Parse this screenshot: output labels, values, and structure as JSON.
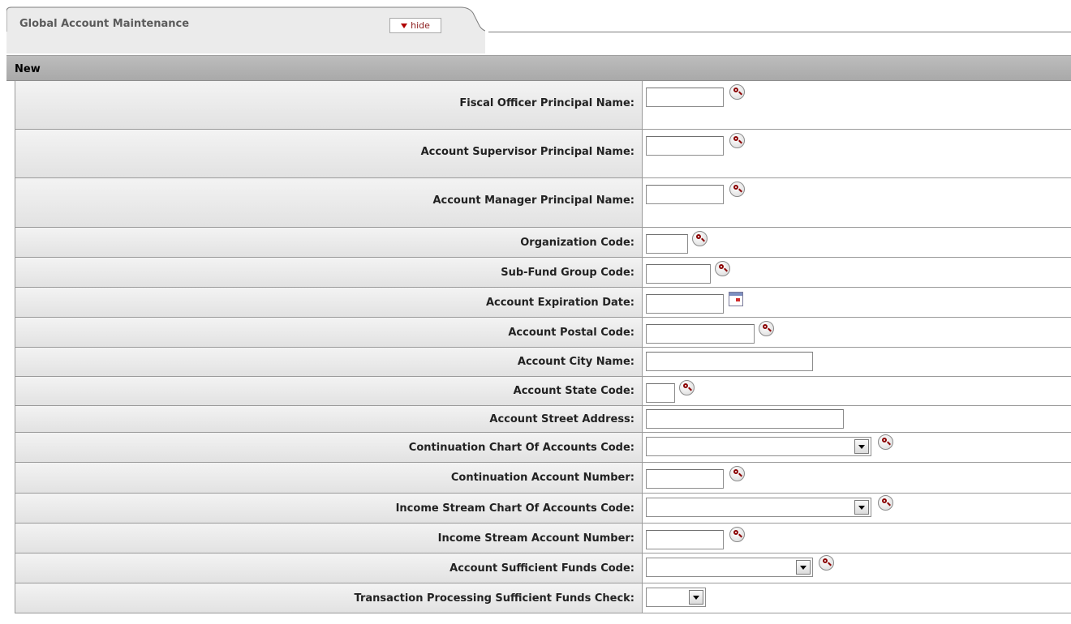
{
  "tab": {
    "title": "Global Account Maintenance",
    "hide_label": "hide"
  },
  "section": {
    "title": "New"
  },
  "fields": [
    {
      "label": "Fiscal Officer Principal Name:",
      "control": "text",
      "value": "",
      "icon": "lookup-icon"
    },
    {
      "label": "Account Supervisor Principal Name:",
      "control": "text",
      "value": "",
      "icon": "lookup-icon"
    },
    {
      "label": "Account Manager Principal Name:",
      "control": "text",
      "value": "",
      "icon": "lookup-icon"
    },
    {
      "label": "Organization Code:",
      "control": "text",
      "value": "",
      "icon": "lookup-icon"
    },
    {
      "label": "Sub-Fund Group Code:",
      "control": "text",
      "value": "",
      "icon": "lookup-icon"
    },
    {
      "label": "Account Expiration Date:",
      "control": "text",
      "value": "",
      "icon": "calendar-icon"
    },
    {
      "label": "Account Postal Code:",
      "control": "text",
      "value": "",
      "icon": "lookup-icon"
    },
    {
      "label": "Account City Name:",
      "control": "text",
      "value": ""
    },
    {
      "label": "Account State Code:",
      "control": "text",
      "value": "",
      "icon": "lookup-icon"
    },
    {
      "label": "Account Street Address:",
      "control": "text",
      "value": ""
    },
    {
      "label": "Continuation Chart Of Accounts Code:",
      "control": "select",
      "value": "",
      "icon": "lookup-icon"
    },
    {
      "label": "Continuation Account Number:",
      "control": "text",
      "value": "",
      "icon": "lookup-icon"
    },
    {
      "label": "Income Stream Chart Of Accounts Code:",
      "control": "select",
      "value": "",
      "icon": "lookup-icon"
    },
    {
      "label": "Income Stream Account Number:",
      "control": "text",
      "value": "",
      "icon": "lookup-icon"
    },
    {
      "label": "Account Sufficient Funds Code:",
      "control": "select",
      "value": "",
      "icon": "lookup-icon"
    },
    {
      "label": "Transaction Processing Sufficient Funds Check:",
      "control": "select",
      "value": ""
    }
  ]
}
